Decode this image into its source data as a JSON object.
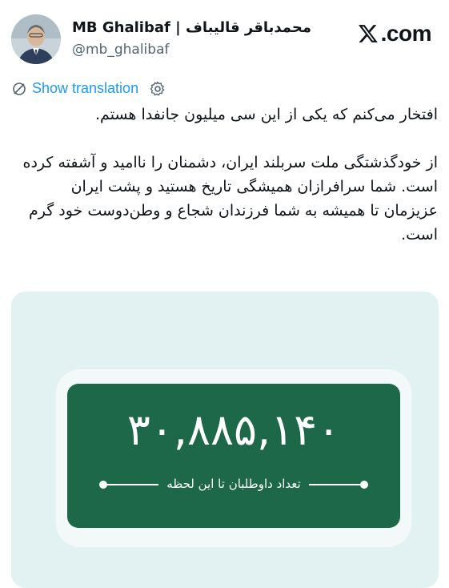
{
  "header": {
    "display_name": "MB Ghalibaf | محمدباقر قالیباف",
    "handle": "@mb_ghalibaf",
    "site_logo_text": ".com"
  },
  "translation": {
    "label": "Show translation"
  },
  "tweet": {
    "text": "افتخار می‌کنم که یکی از این سی میلیون جانفدا هستم.\n\nاز خودگذشتگی ملت سربلند ایران، دشمنان را ناامید و آشفته کرده است. شما سرافرازان همیشگی تاریخ هستید و پشت ایران عزیزمان تا همیشه به شما فرزندان شجاع و وطن‌دوست خود گرم است."
  },
  "media": {
    "counter_value": "۳۰,۸۸۵,۱۴۰",
    "counter_label": "تعداد داوطلبان تا این لحظه"
  },
  "colors": {
    "link": "#1d9bf0",
    "plate_green": "#1c6848",
    "card_bg": "#e2f1f2",
    "handle_gray": "#536471"
  },
  "icons": {
    "translate": "translate-icon",
    "settings": "gear-icon",
    "x_logo": "x-logo-icon",
    "avatar": "avatar"
  }
}
